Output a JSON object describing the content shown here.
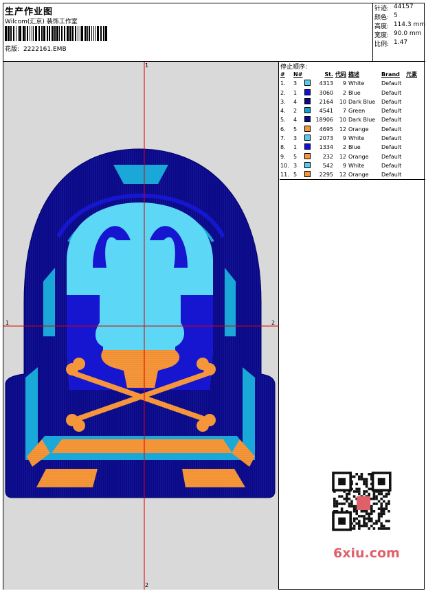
{
  "header": {
    "title": "生产作业图",
    "company": "Wilcom(汇京) 装饰工作室",
    "design_label": "花版:",
    "design_file": "2222161.EMB"
  },
  "stats": [
    {
      "key": "针迹:",
      "value": "44157"
    },
    {
      "key": "颜色:",
      "value": "5"
    },
    {
      "key": "高度:",
      "value": "114.3 mm"
    },
    {
      "key": "宽度:",
      "value": "90.0 mm"
    },
    {
      "key": "比例:",
      "value": "1.47"
    }
  ],
  "axis_labels": {
    "top": "1",
    "left": "1",
    "right": "2",
    "bottom": "2"
  },
  "table": {
    "title": "停止顺序:",
    "headers": {
      "idx": "#",
      "n": "N#",
      "st": "St.",
      "code": "代码",
      "desc": "描述",
      "brand": "Brand",
      "elem": "元素"
    },
    "rows": [
      {
        "idx": "1.",
        "n": "3",
        "color": "#55ccee",
        "st": "4313",
        "code": "9",
        "desc": "White",
        "brand": "Default"
      },
      {
        "idx": "2.",
        "n": "1",
        "color": "#1010dd",
        "st": "3060",
        "code": "2",
        "desc": "Blue",
        "brand": "Default"
      },
      {
        "idx": "3.",
        "n": "4",
        "color": "#0a0a88",
        "st": "2164",
        "code": "10",
        "desc": "Dark Blue",
        "brand": "Default"
      },
      {
        "idx": "4.",
        "n": "2",
        "color": "#10a0cc",
        "st": "4541",
        "code": "7",
        "desc": "Green",
        "brand": "Default"
      },
      {
        "idx": "5.",
        "n": "4",
        "color": "#0a0a88",
        "st": "18906",
        "code": "10",
        "desc": "Dark Blue",
        "brand": "Default"
      },
      {
        "idx": "6.",
        "n": "5",
        "color": "#f5963a",
        "st": "4695",
        "code": "12",
        "desc": "Orange",
        "brand": "Default"
      },
      {
        "idx": "7.",
        "n": "3",
        "color": "#55ccee",
        "st": "2073",
        "code": "9",
        "desc": "White",
        "brand": "Default"
      },
      {
        "idx": "8.",
        "n": "1",
        "color": "#1010dd",
        "st": "1334",
        "code": "2",
        "desc": "Blue",
        "brand": "Default"
      },
      {
        "idx": "9.",
        "n": "5",
        "color": "#f5963a",
        "st": "232",
        "code": "12",
        "desc": "Orange",
        "brand": "Default"
      },
      {
        "idx": "10.",
        "n": "3",
        "color": "#55ccee",
        "st": "542",
        "code": "9",
        "desc": "White",
        "brand": "Default"
      },
      {
        "idx": "11.",
        "n": "5",
        "color": "#f5963a",
        "st": "2295",
        "code": "12",
        "desc": "Orange",
        "brand": "Default"
      }
    ]
  },
  "watermark": "6xiu.com",
  "colors": {
    "dark_blue": "#0a0a88",
    "royal_blue": "#1616d0",
    "light_blue": "#5cd8f6",
    "cyan": "#1aa8d8",
    "orange": "#f5963a",
    "guide": "#dd0000",
    "background": "#d9d9d9"
  }
}
